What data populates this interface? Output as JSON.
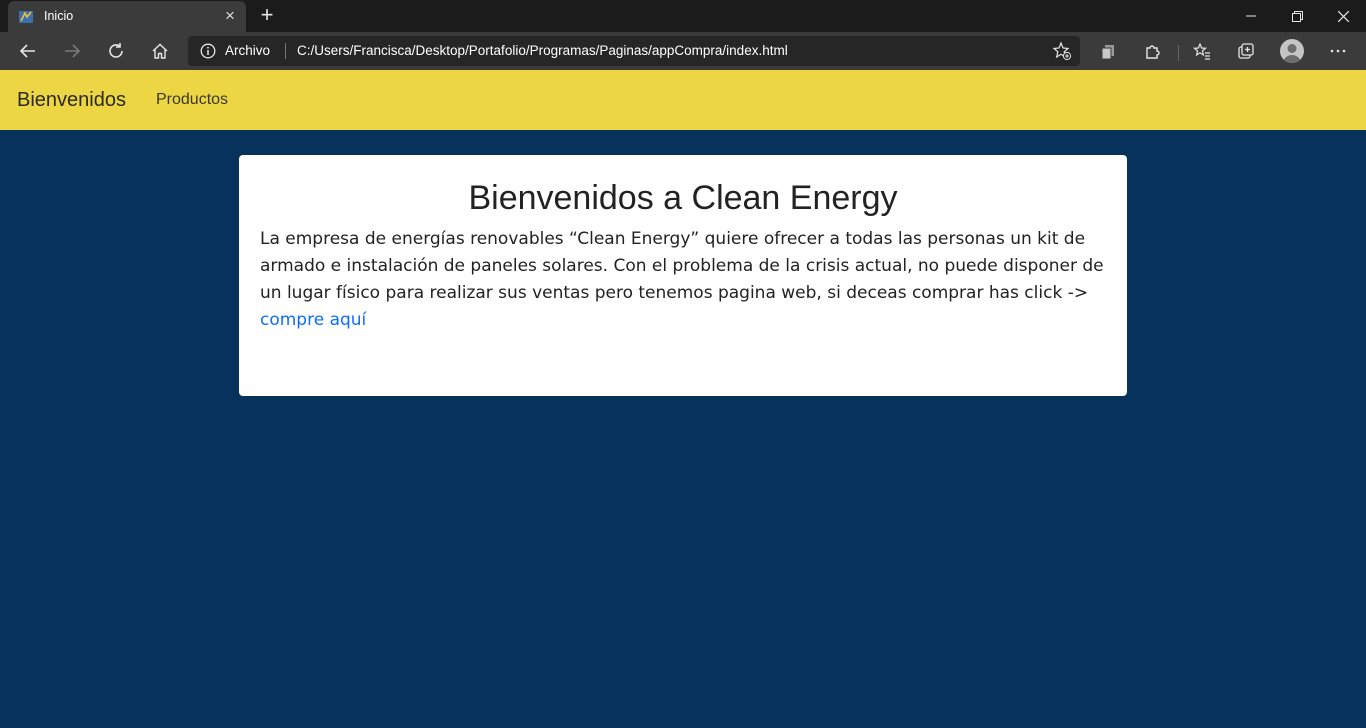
{
  "browser": {
    "tab": {
      "title": "Inicio"
    },
    "address": {
      "scheme_label": "Archivo",
      "url": "C:/Users/Francisca/Desktop/Portafolio/Programas/Paginas/appCompra/index.html"
    }
  },
  "navbar": {
    "brand": "Bienvenidos",
    "links": [
      "Productos"
    ]
  },
  "card": {
    "title": "Bienvenidos a Clean Energy",
    "text": "La empresa de energías renovables “Clean Energy” quiere ofrecer a todas las personas un kit de armado e instalación de paneles solares. Con el problema de la crisis actual, no puede disponer de un lugar físico para realizar sus ventas pero tenemos pagina web, si deceas comprar has click -> ",
    "link_label": "compre aquí"
  },
  "colors": {
    "navbar_bg": "#edd644",
    "page_bg": "#06325c",
    "link": "#0d6efd"
  }
}
